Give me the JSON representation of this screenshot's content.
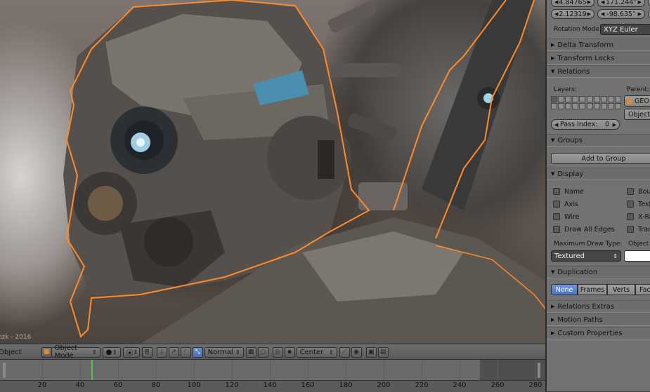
{
  "viewport": {
    "watermark": "ızk - 2016"
  },
  "header": {
    "view_label": "Object",
    "mode": "Object Mode",
    "transform_orientation": "Normal",
    "pivot": "Center"
  },
  "timeline": {
    "ruler": [
      "20",
      "40",
      "60",
      "80",
      "100",
      "120",
      "140",
      "160",
      "180",
      "200",
      "220",
      "240",
      "260",
      "280"
    ],
    "current_frame": 46
  },
  "properties": {
    "values": {
      "loc_y": "4.84765",
      "rot_y": "171.244°",
      "loc_z": "2.12319",
      "rot_z": "-98.635°"
    },
    "rotation_mode_label": "Rotation Mode:",
    "rotation_mode": "XYZ Euler",
    "panels": {
      "delta_transform": "Delta Transform",
      "transform_locks": "Transform Locks",
      "relations": "Relations",
      "groups": "Groups",
      "display": "Display",
      "duplication": "Duplication",
      "relations_extras": "Relations Extras",
      "motion_paths": "Motion Paths",
      "custom_properties": "Custom Properties"
    },
    "relations": {
      "layers_label": "Layers:",
      "parent_label": "Parent:",
      "parent_value": "GEO",
      "parent_type": "Object",
      "pass_index_label": "Pass Index:",
      "pass_index": "0"
    },
    "groups": {
      "add_button": "Add to Group"
    },
    "display": {
      "left": [
        "Name",
        "Axis",
        "Wire",
        "Draw All Edges"
      ],
      "right": [
        "Bour",
        "Textu",
        "X-Ra",
        "Tran"
      ],
      "max_draw_label": "Maximum Draw Type:",
      "max_draw_value": "Textured",
      "object_color_label": "Object C"
    },
    "duplication": {
      "options": [
        "None",
        "Frames",
        "Verts",
        "Fac"
      ],
      "active": "None"
    }
  }
}
